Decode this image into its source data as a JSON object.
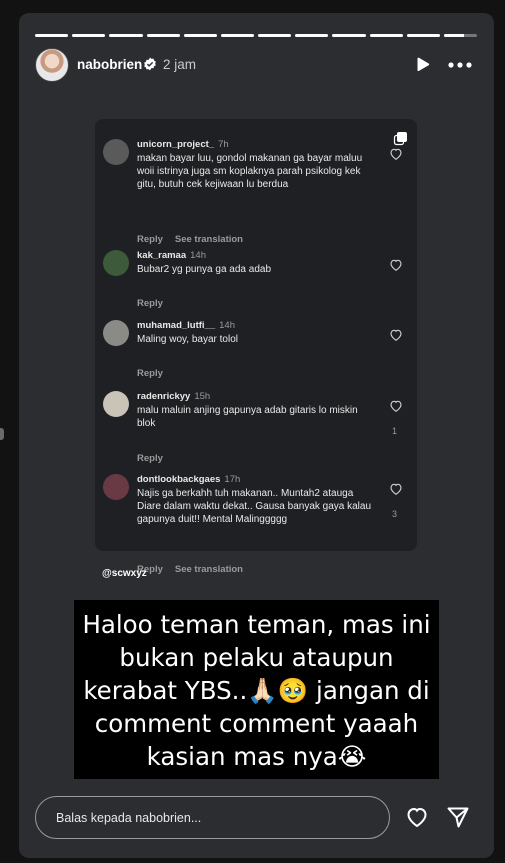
{
  "story": {
    "progress_segments": [
      1,
      1,
      1,
      1,
      1,
      1,
      1,
      1,
      1,
      1,
      1,
      0.6
    ],
    "username": "nabobrien",
    "time": "2 jam",
    "icons": {
      "verified": "verified-icon",
      "play": "play-icon",
      "more": "more-icon"
    }
  },
  "comments": [
    {
      "user": "unicorn_project_",
      "age": "7h",
      "text": "makan bayar luu, gondol makanan ga bayar maluu woii istrinya juga sm koplaknya parah psikolog kek gitu, butuh cek kejiwaan lu berdua",
      "reply": "Reply",
      "translate": "See translation",
      "likes": ""
    },
    {
      "user": "kak_ramaa",
      "age": "14h",
      "text": "Bubar2 yg punya ga ada adab",
      "reply": "Reply",
      "translate": "",
      "likes": ""
    },
    {
      "user": "muhamad_lutfi__",
      "age": "14h",
      "text": "Maling woy, bayar tolol",
      "reply": "Reply",
      "translate": "",
      "likes": ""
    },
    {
      "user": "radenrickyy",
      "age": "15h",
      "text": "malu maluin anjing gapunya adab gitaris lo miskin blok",
      "reply": "Reply",
      "translate": "",
      "likes": "1"
    },
    {
      "user": "dontlookbackgaes",
      "age": "17h",
      "text": "Najis ga berkahh tuh makanan.. Muntah2 atauga Diare dalam waktu dekat.. Gausa banyak gaya kalau gapunya duit!! Mental Malinggggg",
      "reply": "Reply",
      "translate": "See translation",
      "likes": "3"
    }
  ],
  "mention": "@scwxyz",
  "caption": "Haloo teman teman, mas ini bukan pelaku ataupun kerabat YBS..🙏🏻🥹 jangan di comment comment yaaah kasian mas nya😭",
  "reply": {
    "placeholder": "Balas kepada nabobrien..."
  },
  "colors": {
    "background": "#121212",
    "card": "#2b2d30",
    "comment_card": "#1f2023",
    "caption_bg": "#000000"
  }
}
